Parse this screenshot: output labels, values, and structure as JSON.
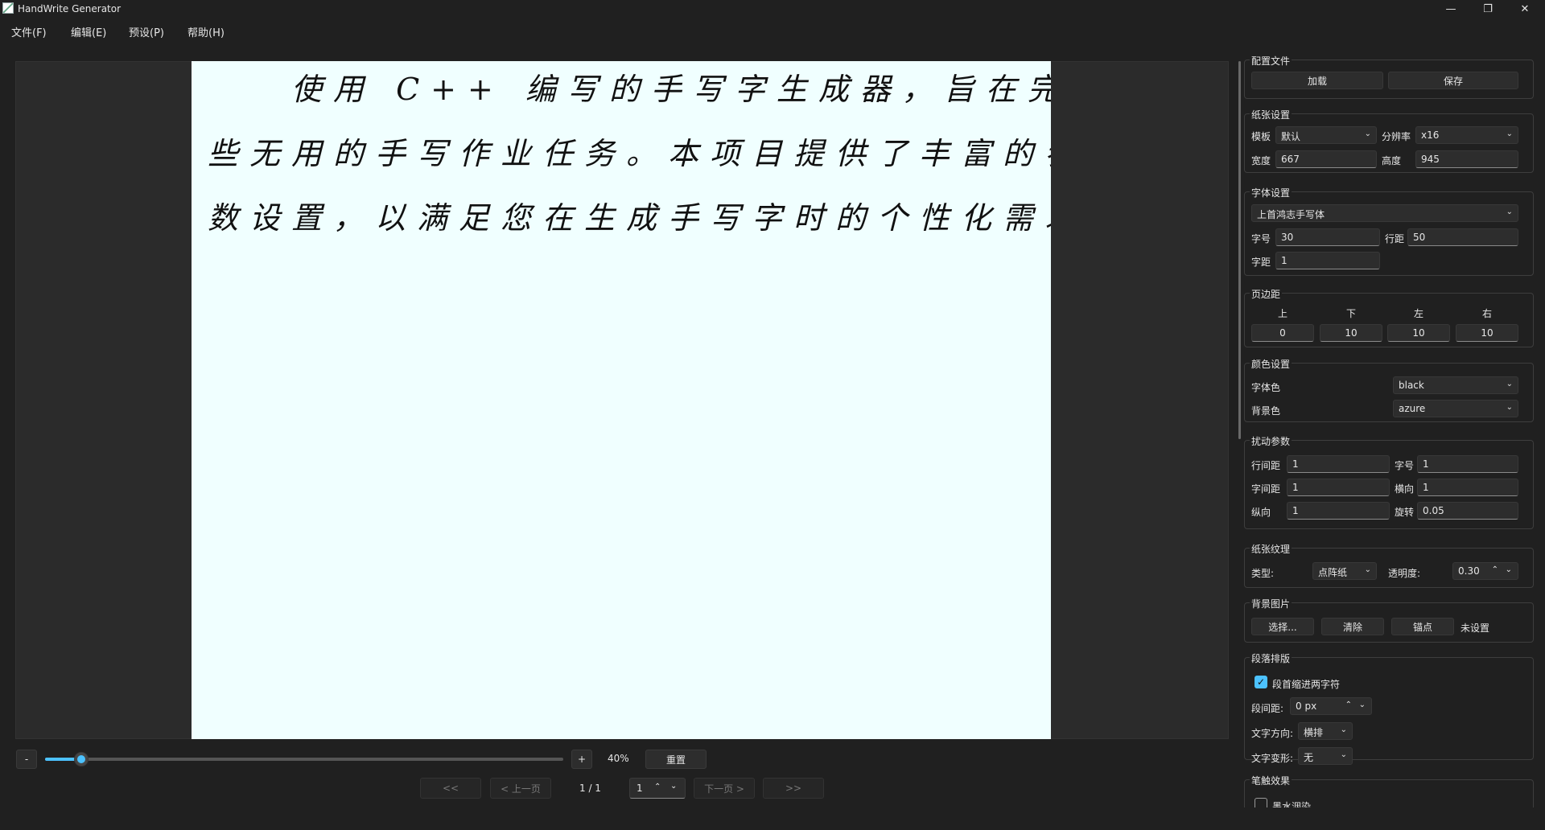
{
  "window": {
    "title": "HandWrite Generator",
    "icon": "app-pen-icon",
    "controls": [
      "minimize-icon",
      "restore-icon",
      "close-icon"
    ]
  },
  "menu": [
    {
      "label": "文件(F)"
    },
    {
      "label": "编辑(E)"
    },
    {
      "label": "预设(P)"
    },
    {
      "label": "帮助(H)"
    }
  ],
  "preview": {
    "lines": [
      "　　使用 C++ 编写的手写字生成器，旨在完成一",
      "些无用的手写作业任务。本项目提供了丰富的参",
      "数设置，以满足您在生成手写字时的个性化需求。"
    ],
    "paper_color": "#f0ffff",
    "text_color": "#000000"
  },
  "zoom": {
    "minus_label": "-",
    "plus_label": "+",
    "value_label": "40%",
    "value_fraction": 0.07,
    "reset_label": "重置"
  },
  "pager": {
    "first_label": "<<",
    "prev_label": "< 上一页",
    "count_label": "1 / 1",
    "current_value": "1",
    "next_label": "下一页 >",
    "last_label": ">>"
  },
  "panel": {
    "profile": {
      "title": "配置文件",
      "load_label": "加载",
      "save_label": "保存"
    },
    "paper": {
      "title": "纸张设置",
      "template_label": "模板",
      "template_value": "默认",
      "resolution_label": "分辨率",
      "resolution_value": "x16",
      "width_label": "宽度",
      "width_value": "667",
      "height_label": "高度",
      "height_value": "945"
    },
    "font": {
      "title": "字体设置",
      "family_value": "上首鸿志手写体",
      "size_label": "字号",
      "size_value": "30",
      "line_spacing_label": "行距",
      "line_spacing_value": "50",
      "char_spacing_label": "字距",
      "char_spacing_value": "1"
    },
    "margins": {
      "title": "页边距",
      "top_label": "上",
      "bottom_label": "下",
      "left_label": "左",
      "right_label": "右",
      "top_value": "0",
      "bottom_value": "10",
      "left_value": "10",
      "right_value": "10"
    },
    "colors": {
      "title": "颜色设置",
      "font_color_label": "字体色",
      "font_color_value": "black",
      "bg_color_label": "背景色",
      "bg_color_value": "azure"
    },
    "jitter": {
      "title": "扰动参数",
      "line_gap_label": "行间距",
      "line_gap_value": "1",
      "size_label": "字号",
      "size_value": "1",
      "char_gap_label": "字间距",
      "char_gap_value": "1",
      "horizontal_label": "横向",
      "horizontal_value": "1",
      "vertical_label": "纵向",
      "vertical_value": "1",
      "rotation_label": "旋转",
      "rotation_value": "0.05"
    },
    "texture": {
      "title": "纸张纹理",
      "type_label": "类型:",
      "type_value": "点阵纸",
      "opacity_label": "透明度:",
      "opacity_value": "0.30"
    },
    "bg_image": {
      "title": "背景图片",
      "choose_label": "选择...",
      "clear_label": "清除",
      "anchor_label": "锚点",
      "status": "未设置"
    },
    "paragraph": {
      "title": "段落排版",
      "indent_label": "段首缩进两字符",
      "indent_checked": true,
      "para_spacing_label": "段间距:",
      "para_spacing_value": "0 px",
      "direction_label": "文字方向:",
      "direction_value": "横排",
      "transform_label": "文字变形:",
      "transform_value": "无"
    },
    "stroke": {
      "title": "笔触效果",
      "ink_label": "墨水洇染",
      "ink_checked": false
    }
  },
  "colors": {
    "accent": "#4cc2ff",
    "window_bg": "#202020"
  }
}
